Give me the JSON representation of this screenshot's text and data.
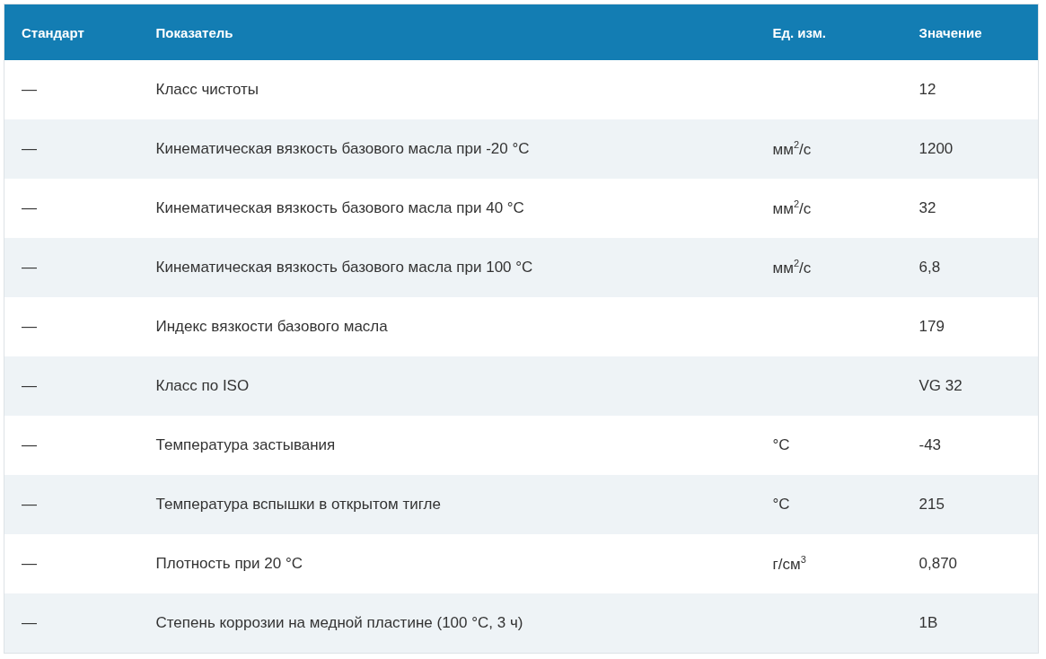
{
  "table": {
    "columns": [
      "Стандарт",
      "Показатель",
      "Ед. изм.",
      "Значение"
    ],
    "rows": [
      [
        "—",
        "Класс чистоты",
        "",
        "12"
      ],
      [
        "—",
        "Кинематическая вязкость базового масла при -20 °C",
        "мм$^{2}$/с",
        "1200"
      ],
      [
        "—",
        "Кинематическая вязкость базового масла при 40 °C",
        "мм$^{2}$/с",
        "32"
      ],
      [
        "—",
        "Кинематическая вязкость базового масла при 100 °C",
        "мм$^{2}$/с",
        "6,8"
      ],
      [
        "—",
        "Индекс вязкости базового масла",
        "",
        "179"
      ],
      [
        "—",
        "Класс по ISO",
        "",
        "VG 32"
      ],
      [
        "—",
        "Температура застывания",
        "°C",
        "-43"
      ],
      [
        "—",
        "Температура вспышки в открытом тигле",
        "°C",
        "215"
      ],
      [
        "—",
        "Плотность при 20 °C",
        "г/см$^{3}$",
        "0,870"
      ],
      [
        "—",
        "Степень коррозии на медной пластине (100 °C, 3 ч)",
        "",
        "1В"
      ]
    ]
  }
}
